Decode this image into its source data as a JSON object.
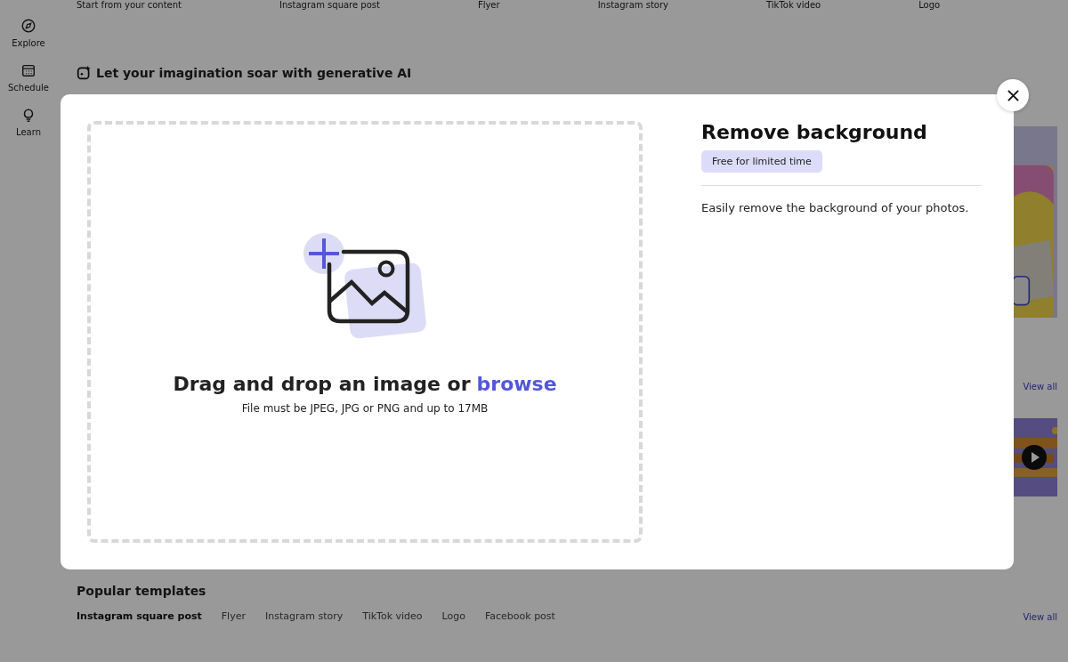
{
  "sidebar": {
    "items": [
      {
        "label": "Explore",
        "kind": "explore"
      },
      {
        "label": "Schedule",
        "kind": "schedule"
      },
      {
        "label": "Learn",
        "kind": "learn"
      }
    ]
  },
  "quick_actions": [
    "Start from your content",
    "Instagram square post",
    "Flyer",
    "Instagram story",
    "TikTok video",
    "Logo"
  ],
  "generative_section": {
    "title": "Let your imagination soar with generative AI",
    "view_all": "View all"
  },
  "popular_templates": {
    "title": "Popular templates",
    "tabs": [
      {
        "label": "Instagram square post",
        "selected": true
      },
      {
        "label": "Flyer",
        "selected": false
      },
      {
        "label": "Instagram story",
        "selected": false
      },
      {
        "label": "TikTok video",
        "selected": false
      },
      {
        "label": "Logo",
        "selected": false
      },
      {
        "label": "Facebook post",
        "selected": false
      }
    ],
    "view_all": "View all"
  },
  "dialog": {
    "upload": {
      "prompt": "Drag and drop an image or",
      "link": "browse",
      "hint": "File must be JPEG, JPG or PNG and up to 17MB"
    },
    "title": "Remove background",
    "badge": "Free for limited time",
    "description": "Easily remove the background of your photos."
  }
}
